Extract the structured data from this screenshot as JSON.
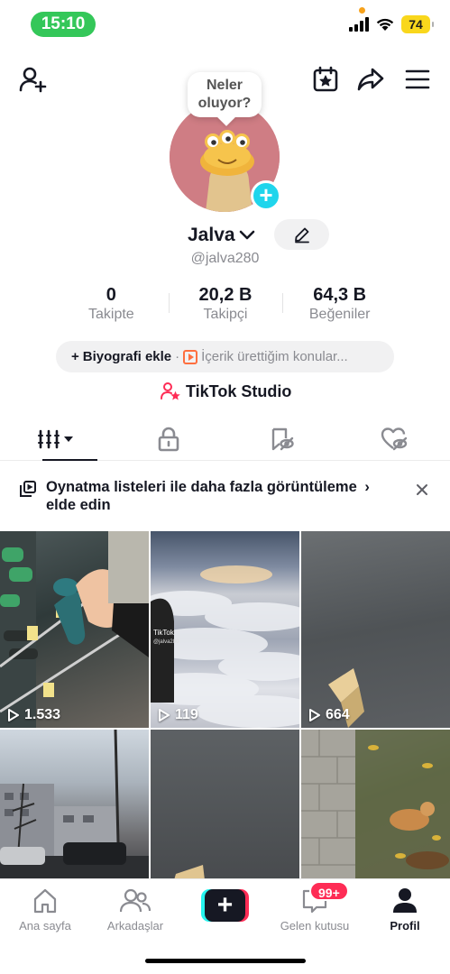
{
  "status_bar": {
    "time": "15:10",
    "battery": "74"
  },
  "avatar": {
    "speech_line1": "Neler",
    "speech_line2": "oluyor?"
  },
  "profile": {
    "name": "Jalva",
    "handle": "@jalva280",
    "stats": [
      {
        "value": "0",
        "label": "Takipte"
      },
      {
        "value": "20,2 B",
        "label": "Takipçi"
      },
      {
        "value": "64,3 B",
        "label": "Beğeniler"
      }
    ],
    "bio_add": "Biyografi ekle",
    "bio_separator": "·",
    "bio_topics": "İçerik ürettiğim konular...",
    "studio": "TikTok Studio"
  },
  "banner": {
    "text": "Oynatma listeleri ile daha fazla görüntüleme edin",
    "text_line1": "Oynatma listeleri ile daha fazla görüntüleme",
    "text_line2": "elde edin"
  },
  "videos": [
    {
      "views": "1.533"
    },
    {
      "views": "119"
    },
    {
      "views": "664"
    },
    {
      "views": ""
    },
    {
      "views": ""
    },
    {
      "views": ""
    }
  ],
  "bottom_nav": {
    "home": "Ana sayfa",
    "friends": "Arkadaşlar",
    "inbox": "Gelen kutusu",
    "inbox_badge": "99+",
    "profile": "Profil"
  },
  "colors": {
    "accent": "#fe2c55",
    "cyan": "#25f4ee",
    "status_green": "#34c759"
  }
}
